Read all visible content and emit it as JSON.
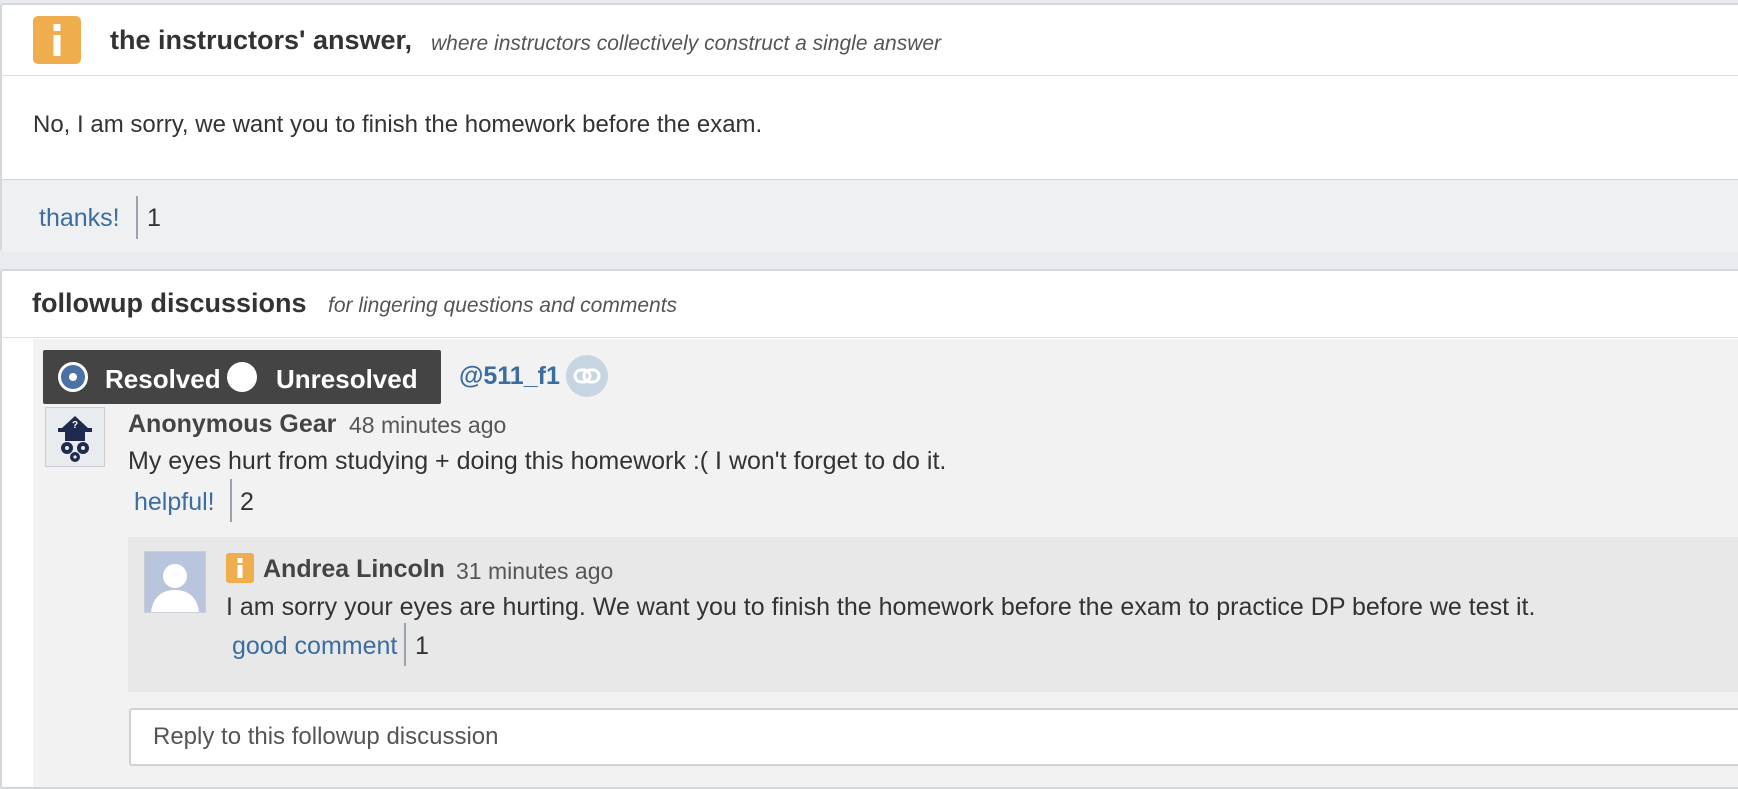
{
  "answer": {
    "title": "the instructors' answer,",
    "subtitle": "where instructors collectively construct a single answer",
    "body": "No, I am sorry, we want you to finish the homework before the exam.",
    "thanks_label": "thanks!",
    "thanks_count": "1",
    "badge_icon": "info-icon",
    "badge_color": "#f0ad4e"
  },
  "followup": {
    "title": "followup discussions",
    "subtitle": "for lingering questions and comments",
    "resolved_label": "Resolved",
    "unresolved_label": "Unresolved",
    "selected_status": "Resolved",
    "post_ref": "@511_f1",
    "link_icon": "link-icon",
    "comment": {
      "author": "Anonymous Gear",
      "time": "48 minutes ago",
      "text": "My eyes hurt from studying + doing this homework :( I won't forget to do it.",
      "helpful_label": "helpful!",
      "helpful_count": "2",
      "avatar_icon": "anonymous-gear-avatar"
    },
    "reply": {
      "author": "Andrea Lincoln",
      "time": "31 minutes ago",
      "text": "I am sorry your eyes are hurting. We want you to finish the homework before the exam to practice DP before we test it.",
      "good_label": "good comment",
      "good_count": "1",
      "avatar_icon": "default-user-avatar",
      "badge_icon": "instructor-info-icon"
    },
    "reply_placeholder": "Reply to this followup discussion"
  },
  "colors": {
    "link": "#3b6da0",
    "accent_orange": "#f0ad4e",
    "resolve_bar": "#444444",
    "selected_radio": "#4a72a6"
  }
}
